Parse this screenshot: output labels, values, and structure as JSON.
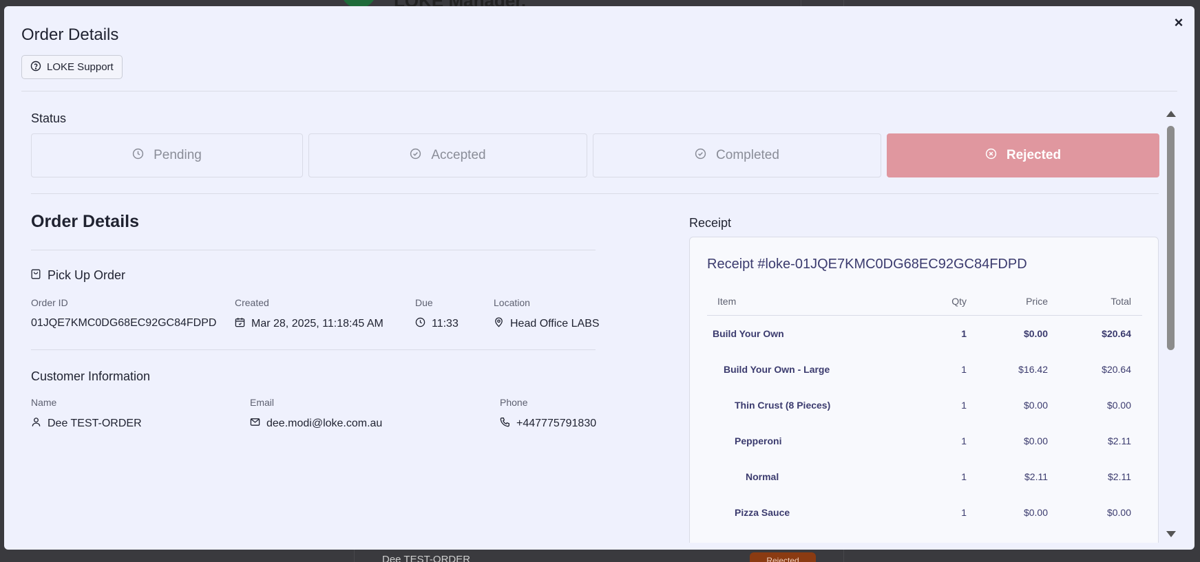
{
  "background": {
    "app_title": "LOKE Manager.",
    "row_name": "Dee TEST-ORDER",
    "row_badge": "Rejected"
  },
  "modal": {
    "title": "Order Details",
    "support_label": "LOKE Support",
    "close_label": "×"
  },
  "status": {
    "label": "Status",
    "options": [
      {
        "label": "Pending",
        "icon": "clock-icon",
        "active": false
      },
      {
        "label": "Accepted",
        "icon": "check-circle-icon",
        "active": false
      },
      {
        "label": "Completed",
        "icon": "check-circle-icon",
        "active": false
      },
      {
        "label": "Rejected",
        "icon": "x-circle-icon",
        "active": true
      }
    ],
    "active_color": "#e0979f"
  },
  "order": {
    "title": "Order Details",
    "type": "Pick Up Order",
    "id_label": "Order ID",
    "id_value": "01JQE7KMC0DG68EC92GC84FDPD",
    "created_label": "Created",
    "created_value": "Mar 28, 2025, 11:18:45 AM",
    "due_label": "Due",
    "due_value": "11:33",
    "location_label": "Location",
    "location_value": "Head Office LABS"
  },
  "customer": {
    "title": "Customer Information",
    "name_label": "Name",
    "name_value": "Dee TEST-ORDER",
    "email_label": "Email",
    "email_value": "dee.modi@loke.com.au",
    "phone_label": "Phone",
    "phone_value": "+447775791830"
  },
  "receipt": {
    "label": "Receipt",
    "title": "Receipt #loke-01JQE7KMC0DG68EC92GC84FDPD",
    "headers": {
      "item": "Item",
      "qty": "Qty",
      "price": "Price",
      "total": "Total"
    },
    "rows": [
      {
        "item": "Build Your Own",
        "qty": "1",
        "price": "$0.00",
        "total": "$20.64",
        "level": 0
      },
      {
        "item": "Build Your Own - Large",
        "qty": "1",
        "price": "$16.42",
        "total": "$20.64",
        "level": 1
      },
      {
        "item": "Thin Crust (8 Pieces)",
        "qty": "1",
        "price": "$0.00",
        "total": "$0.00",
        "level": 2
      },
      {
        "item": "Pepperoni",
        "qty": "1",
        "price": "$0.00",
        "total": "$2.11",
        "level": 2
      },
      {
        "item": "Normal",
        "qty": "1",
        "price": "$2.11",
        "total": "$2.11",
        "level": 3
      },
      {
        "item": "Pizza Sauce",
        "qty": "1",
        "price": "$0.00",
        "total": "$0.00",
        "level": 2
      }
    ]
  }
}
